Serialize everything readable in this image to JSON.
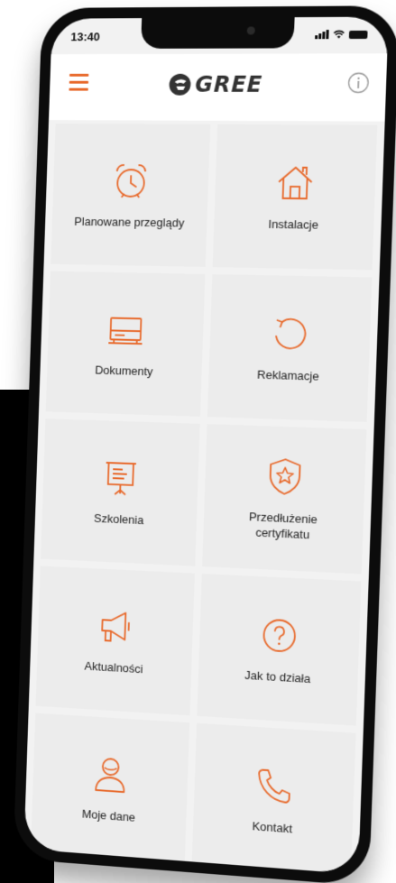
{
  "status_bar": {
    "time": "13:40"
  },
  "header": {
    "menu_icon": "hamburger-menu-icon",
    "logo_text": "GREE",
    "info_icon": "info-icon"
  },
  "colors": {
    "accent": "#e8692b",
    "tile_bg": "#ececec",
    "screen_bg": "#f2f2f2",
    "header_bg": "#ffffff",
    "text": "#222222"
  },
  "menu": {
    "items": [
      {
        "label": "Planowane przeglądy",
        "icon": "alarm-clock-icon"
      },
      {
        "label": "Instalacje",
        "icon": "house-icon"
      },
      {
        "label": "Dokumenty",
        "icon": "documents-tray-icon"
      },
      {
        "label": "Reklamacje",
        "icon": "circular-arrow-icon"
      },
      {
        "label": "Szkolenia",
        "icon": "presentation-board-icon"
      },
      {
        "label": "Przedłużenie\ncertyfikatu",
        "icon": "shield-star-icon"
      },
      {
        "label": "Aktualności",
        "icon": "megaphone-icon"
      },
      {
        "label": "Jak to działa",
        "icon": "question-circle-icon"
      },
      {
        "label": "Moje dane",
        "icon": "user-icon"
      },
      {
        "label": "Kontakt",
        "icon": "phone-handset-icon"
      }
    ]
  }
}
